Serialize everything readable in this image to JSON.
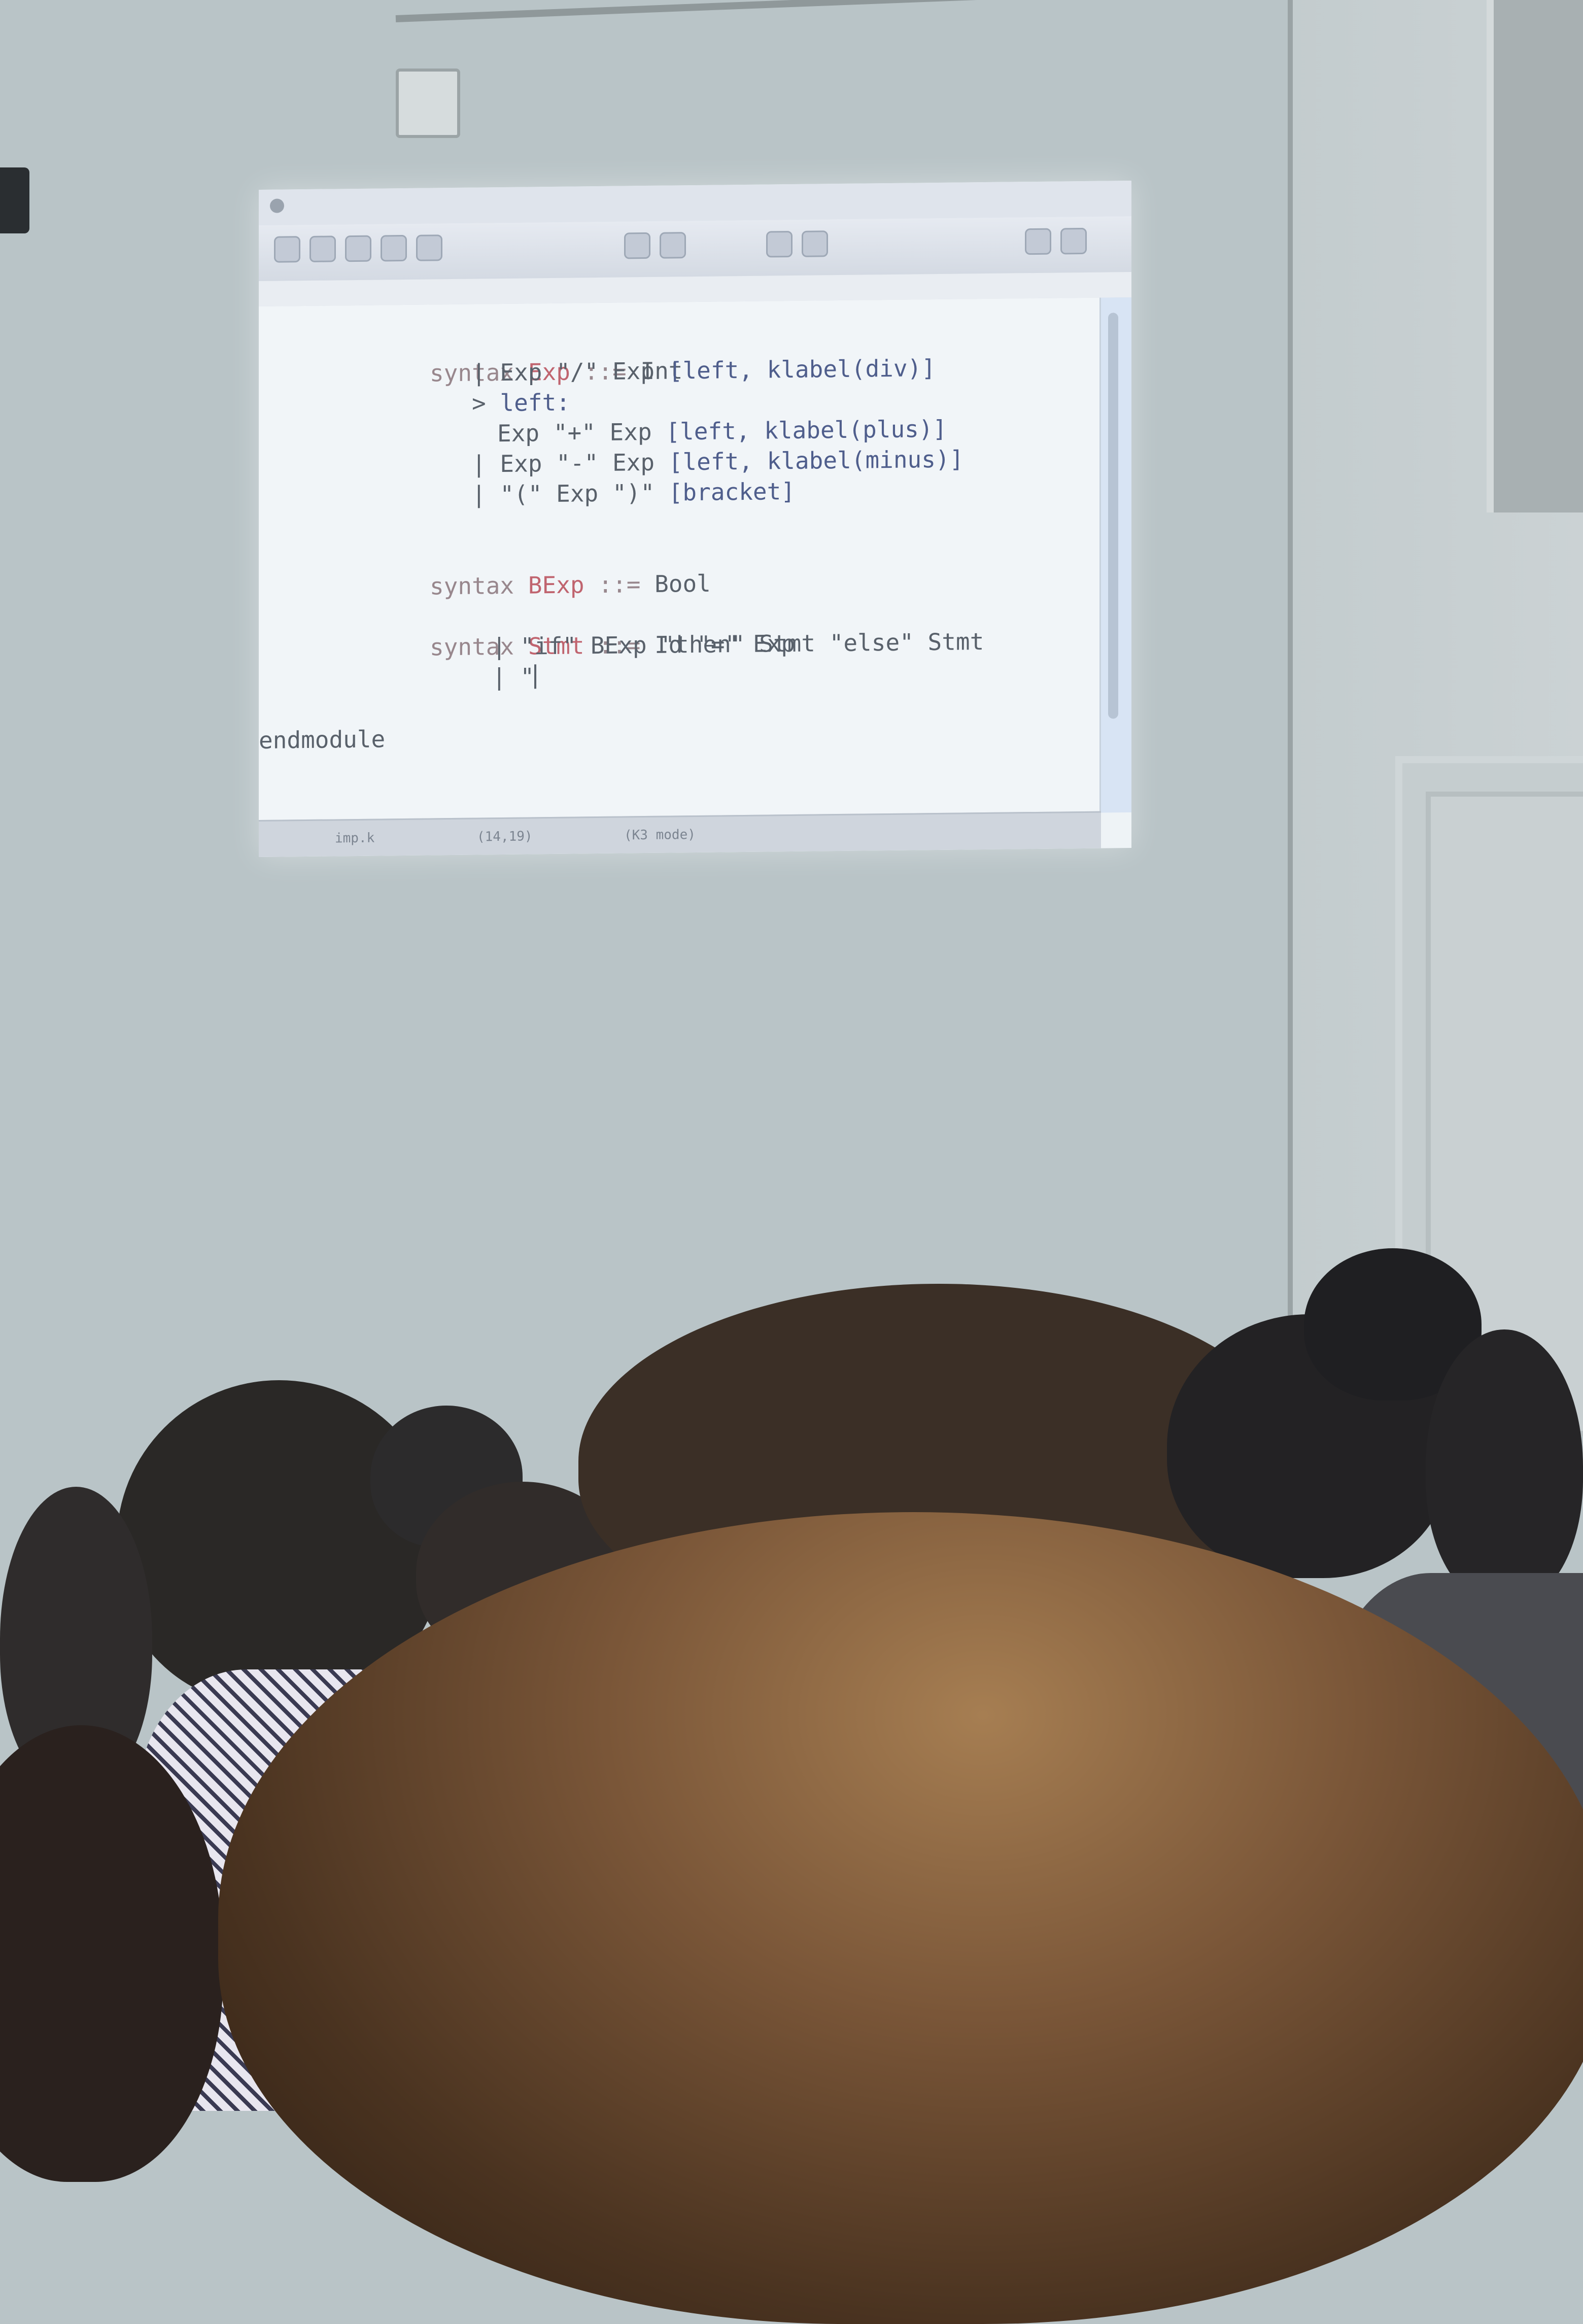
{
  "editor": {
    "code_lines": [
      "syntax Exp ::= Int",
      "| Exp \"/\" Exp [left, klabel(div)]",
      "> left:",
      "Exp \"+\" Exp [left, klabel(plus)]",
      "| Exp \"-\" Exp [left, klabel(minus)]",
      "| \"(\" Exp \")\" [bracket]",
      "syntax BExp ::= Bool",
      "syntax Stmt ::= Id \"=\" Exp",
      "| \"if\" BExp \"then\" Stmt \"else\" Stmt",
      "| \"",
      "endmodule"
    ],
    "status": {
      "buffer": "imp.k",
      "position": "(14,19)",
      "mode": "(K3 mode)"
    }
  },
  "colors": {
    "keyword": "#98878d",
    "type_name": "#c0646f",
    "attribute": "#4f5e8c",
    "text": "#59616b",
    "wall": "#b9c4c7"
  }
}
